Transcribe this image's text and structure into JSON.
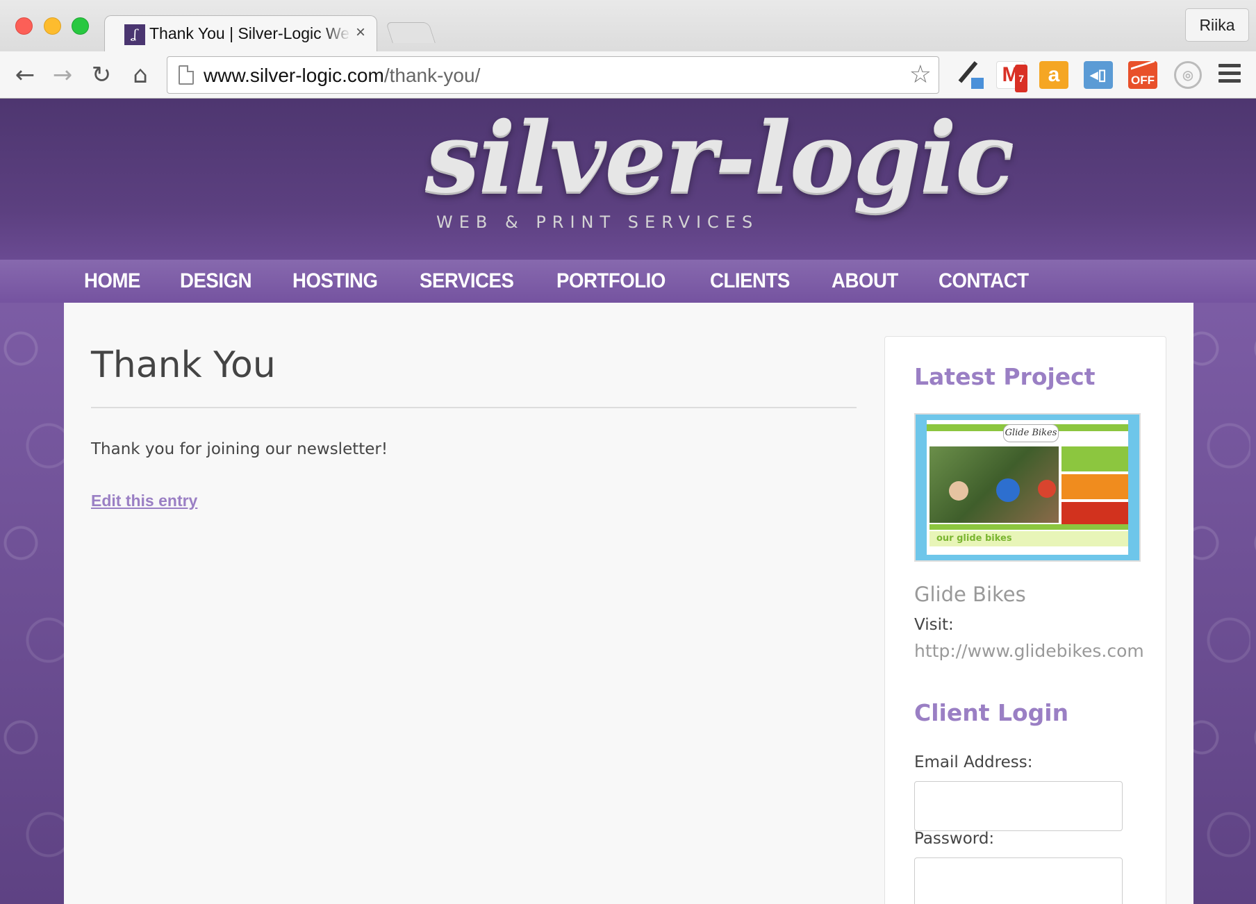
{
  "browser": {
    "tab_title": "Thank You | Silver-Logic Web",
    "tab_close": "×",
    "profile_name": "Riika",
    "url_host": "www.silver-logic.com",
    "url_path": "/thank-you/",
    "icons": {
      "back": "←",
      "forward": "→",
      "reload": "↻",
      "home": "⌂",
      "star": "☆"
    },
    "extensions": {
      "gmail_letter": "M",
      "gmail_badge": "7",
      "amazon_letter": "a",
      "tag_glyph": "◂▯",
      "off_label": "OFF",
      "camera_glyph": "◎"
    }
  },
  "site": {
    "logo_text": "silver-logic",
    "logo_tagline": "WEB & PRINT SERVICES",
    "nav": [
      "HOME",
      "DESIGN",
      "HOSTING",
      "SERVICES",
      "PORTFOLIO",
      "CLIENTS",
      "ABOUT",
      "CONTACT"
    ],
    "colors": {
      "brand_purple": "#4e3670",
      "accent_lavender": "#9a7fc4"
    }
  },
  "main": {
    "title": "Thank You",
    "body": "Thank you for joining our newsletter!",
    "edit_link": "Edit this entry"
  },
  "sidebar": {
    "latest_heading": "Latest Project",
    "screenshot_logo": "Glide Bikes",
    "screenshot_bar": "our glide bikes",
    "project_name": "Glide Bikes",
    "visit_label": "Visit:",
    "visit_url": "http://www.glidebikes.com",
    "login_heading": "Client Login",
    "email_label": "Email Address:",
    "email_value": "",
    "password_label": "Password:",
    "password_value": ""
  }
}
